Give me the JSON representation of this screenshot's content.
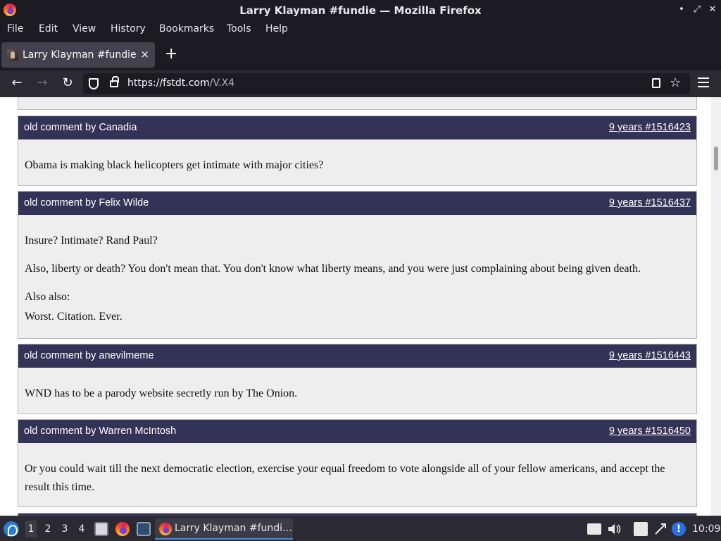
{
  "window": {
    "title": "Larry Klayman #fundie — Mozilla Firefox",
    "controls": [
      "•",
      "⤢",
      "✕"
    ]
  },
  "menu": [
    "File",
    "Edit",
    "View",
    "History",
    "Bookmarks",
    "Tools",
    "Help"
  ],
  "tab": {
    "label": "Larry Klayman #fundie",
    "close": "×",
    "new": "+"
  },
  "nav": {
    "back": "←",
    "forward": "→",
    "reload": "↻",
    "url_host": "https://fstdt.com",
    "url_rest": "/V.X4",
    "star": "☆"
  },
  "comments": [
    {
      "author": "old comment by Canadia",
      "meta": "9 years #1516423",
      "paragraphs": [
        "Obama is making black helicopters get intimate with major cities?"
      ]
    },
    {
      "author": "old comment by Felix Wilde",
      "meta": "9 years #1516437",
      "paragraphs": [
        "Insure? Intimate? Rand Paul?",
        "Also, liberty or death? You don't mean that. You don't know what liberty means, and you were just complaining about being given death.",
        "Also also:",
        "Worst. Citation. Ever."
      ]
    },
    {
      "author": "old comment by anevilmeme",
      "meta": "9 years #1516443",
      "paragraphs": [
        "WND has to be a parody website secretly run by The Onion."
      ]
    },
    {
      "author": "old comment by Warren McIntosh",
      "meta": "9 years #1516450",
      "paragraphs": [
        "Or you could wait till the next democratic election, exercise your equal freedom to vote alongside all of your fellow americans, and accept the result this time."
      ]
    }
  ],
  "taskbar": {
    "workspaces": [
      "1",
      "2",
      "3",
      "4"
    ],
    "task_label": "Larry Klayman #fundi…",
    "clock": "10:09"
  },
  "colors": {
    "comment_header": "#333358",
    "comment_body": "#eeeeee",
    "chrome": "#1c1b22"
  }
}
